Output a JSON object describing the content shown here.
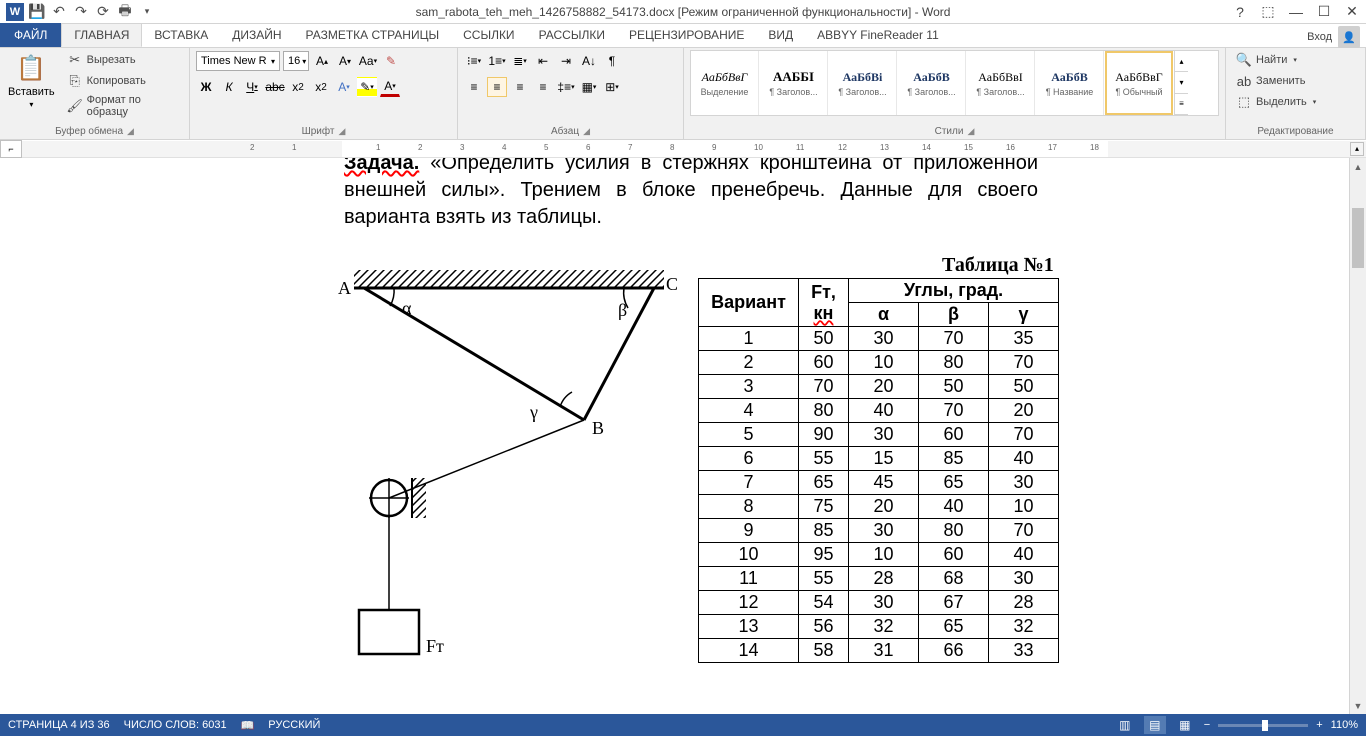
{
  "title": "sam_rabota_teh_meh_1426758882_54173.docx [Режим ограниченной функциональности] - Word",
  "signin_label": "Вход",
  "tabs": {
    "file": "ФАЙЛ",
    "home": "ГЛАВНАЯ",
    "insert": "ВСТАВКА",
    "design": "ДИЗАЙН",
    "layout": "РАЗМЕТКА СТРАНИЦЫ",
    "refs": "ССЫЛКИ",
    "mailings": "РАССЫЛКИ",
    "review": "РЕЦЕНЗИРОВАНИЕ",
    "view": "ВИД",
    "abbyy": "ABBYY FineReader 11"
  },
  "clipboard": {
    "paste": "Вставить",
    "cut": "Вырезать",
    "copy": "Копировать",
    "format_painter": "Формат по образцу",
    "group": "Буфер обмена"
  },
  "font": {
    "name": "Times New R",
    "size": "16",
    "group": "Шрифт"
  },
  "para": {
    "group": "Абзац"
  },
  "styles": {
    "items": [
      "АаБбВвГ",
      "ААББІ",
      "АаБбВі",
      "АаБбВ",
      "АаБбВвІ",
      "АаБбВ",
      "АаБбВвГ"
    ],
    "names": [
      "Выделение",
      "¶ Заголов...",
      "¶ Заголов...",
      "¶ Заголов...",
      "¶ Заголов...",
      "¶ Название",
      "¶ Обычный"
    ],
    "group": "Стили"
  },
  "editing": {
    "find": "Найти",
    "replace": "Заменить",
    "select": "Выделить",
    "group": "Редактирование"
  },
  "document": {
    "task_bold": "Задача.",
    "task_text": " «Определить усилия в стержнях кронштейна от приложенной внешней силы». Трением в блоке пренебречь. Данные для своего варианта взять из таблицы.",
    "labels": {
      "A": "A",
      "B": "B",
      "C": "C",
      "alpha": "α",
      "beta": "β",
      "gamma": "γ",
      "ft": "Fᴛ"
    },
    "table_title": "Таблица №1",
    "headers": {
      "variant": "Вариант",
      "ft": "Fᴛ, ",
      "ft_u": "кн",
      "angles": "Углы, град.",
      "a": "α",
      "b": "β",
      "g": "γ"
    }
  },
  "chart_data": {
    "type": "table",
    "title": "Таблица №1",
    "columns": [
      "Вариант",
      "Fт, кн",
      "α",
      "β",
      "γ"
    ],
    "rows": [
      [
        1,
        50,
        30,
        70,
        35
      ],
      [
        2,
        60,
        10,
        80,
        70
      ],
      [
        3,
        70,
        20,
        50,
        50
      ],
      [
        4,
        80,
        40,
        70,
        20
      ],
      [
        5,
        90,
        30,
        60,
        70
      ],
      [
        6,
        55,
        15,
        85,
        40
      ],
      [
        7,
        65,
        45,
        65,
        30
      ],
      [
        8,
        75,
        20,
        40,
        10
      ],
      [
        9,
        85,
        30,
        80,
        70
      ],
      [
        10,
        95,
        10,
        60,
        40
      ],
      [
        11,
        55,
        28,
        68,
        30
      ],
      [
        12,
        54,
        30,
        67,
        28
      ],
      [
        13,
        56,
        32,
        65,
        32
      ],
      [
        14,
        58,
        31,
        66,
        33
      ]
    ]
  },
  "status": {
    "page": "СТРАНИЦА 4 ИЗ 36",
    "words": "ЧИСЛО СЛОВ: 6031",
    "lang": "РУССКИЙ",
    "zoom": "110%"
  },
  "ruler_ticks": [
    "2",
    "1",
    "",
    "1",
    "2",
    "3",
    "4",
    "5",
    "6",
    "7",
    "8",
    "9",
    "10",
    "11",
    "12",
    "13",
    "14",
    "15",
    "16",
    "17",
    "18"
  ]
}
